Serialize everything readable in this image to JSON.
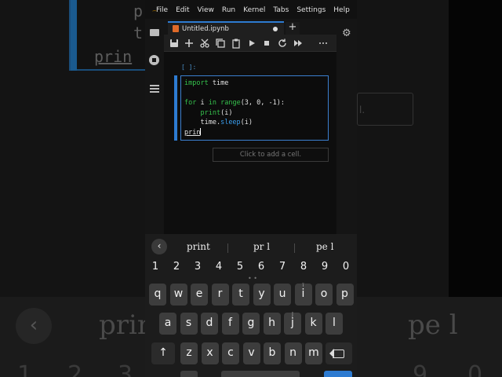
{
  "background": {
    "code_lines": [
      "p",
      "t",
      "prin"
    ],
    "add_cell_fragment": "l.",
    "keyboard_suggestions": [
      "prin",
      "pe l"
    ],
    "keyboard_numbers": [
      "1",
      "2",
      "3",
      "9",
      "0"
    ]
  },
  "menubar": {
    "items": [
      "File",
      "Edit",
      "View",
      "Run",
      "Kernel",
      "Tabs",
      "Settings",
      "Help"
    ]
  },
  "tab": {
    "title": "Untitled.ipynb",
    "add_symbol": "+"
  },
  "cell": {
    "prompt": "[ ]:",
    "code": {
      "l1_kw": "import",
      "l1_rest": " time",
      "l3_kw1": "for",
      "l3_a": " i ",
      "l3_kw2": "in",
      "l3_sp": " ",
      "l3_bi": "range",
      "l3_b": "(3, 0, -1):",
      "l4_bi": "print",
      "l4_b": "(i)",
      "l5_a": "time.",
      "l5_fn": "sleep",
      "l5_b": "(i)",
      "l6": "prin"
    }
  },
  "add_cell_hint": "Click to add a cell.",
  "keyboard": {
    "suggestions": [
      "print",
      "pr l",
      "pe l"
    ],
    "numbers": [
      "1",
      "2",
      "3",
      "4",
      "5",
      "6",
      "7",
      "8",
      "9",
      "0"
    ],
    "row1": [
      "q",
      "w",
      "e",
      "r",
      "t",
      "y",
      "u",
      "i",
      "o",
      "p"
    ],
    "row1_hints": [
      "",
      "",
      "",
      "",
      "",
      "",
      "",
      "ï",
      "",
      ""
    ],
    "row2": [
      "a",
      "s",
      "d",
      "f",
      "g",
      "h",
      "j",
      "k",
      "l"
    ],
    "row2_hints": [
      "",
      "",
      "",
      "",
      "",
      "",
      "ĵ",
      "",
      ""
    ],
    "row3": [
      "z",
      "x",
      "c",
      "v",
      "b",
      "n",
      "m"
    ],
    "shift_symbol": "↑"
  },
  "colors": {
    "accent": "#2d7bd1",
    "keyword": "#35c14c",
    "function": "#3a9ff0",
    "logo": "#f3b51b"
  }
}
